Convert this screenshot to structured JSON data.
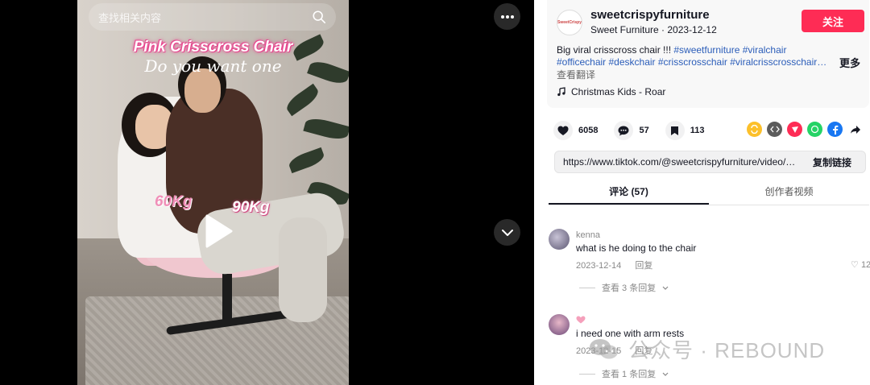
{
  "search": {
    "placeholder": "查找相关内容"
  },
  "video": {
    "overlay_title": "Pink Crisscross Chair",
    "overlay_subtitle": "Do you want one",
    "label_left": "60Kg",
    "label_right": "90Kg"
  },
  "author": {
    "username": "sweetcrispyfurniture",
    "subline": "Sweet Furniture · 2023-12-12",
    "avatar_text": "SweetCrispy",
    "follow_label": "关注"
  },
  "description": {
    "text": "Big viral crisscross chair !!! ",
    "tags": [
      "#sweetfurniture",
      "#viralchair",
      "#officechair",
      "#deskchair",
      "#crisscrosschair",
      "#viralcrisscrosschair…"
    ],
    "more_label": "更多",
    "translate_label": "查看翻译"
  },
  "music": {
    "title": "Christmas Kids - Roar"
  },
  "stats": {
    "likes": "6058",
    "comments": "57",
    "saves": "113"
  },
  "link": {
    "url": "https://www.tiktok.com/@sweetcrispyfurniture/video/73…",
    "copy_label": "复制链接"
  },
  "tabs": [
    {
      "label": "评论 (57)"
    },
    {
      "label": "创作者视频"
    }
  ],
  "comments": [
    {
      "name": "kenna",
      "text": "what is he doing to the chair",
      "date": "2023-12-14",
      "reply_label": "回复",
      "likes": "12",
      "view_replies": "查看 3 条回复"
    },
    {
      "name": "",
      "text": "i need one with arm rests",
      "date": "2023-12-15",
      "reply_label": "回复",
      "likes": "1",
      "view_replies": "查看 1 条回复"
    }
  ],
  "watermark": {
    "text": "公众号 · REBOUND"
  }
}
